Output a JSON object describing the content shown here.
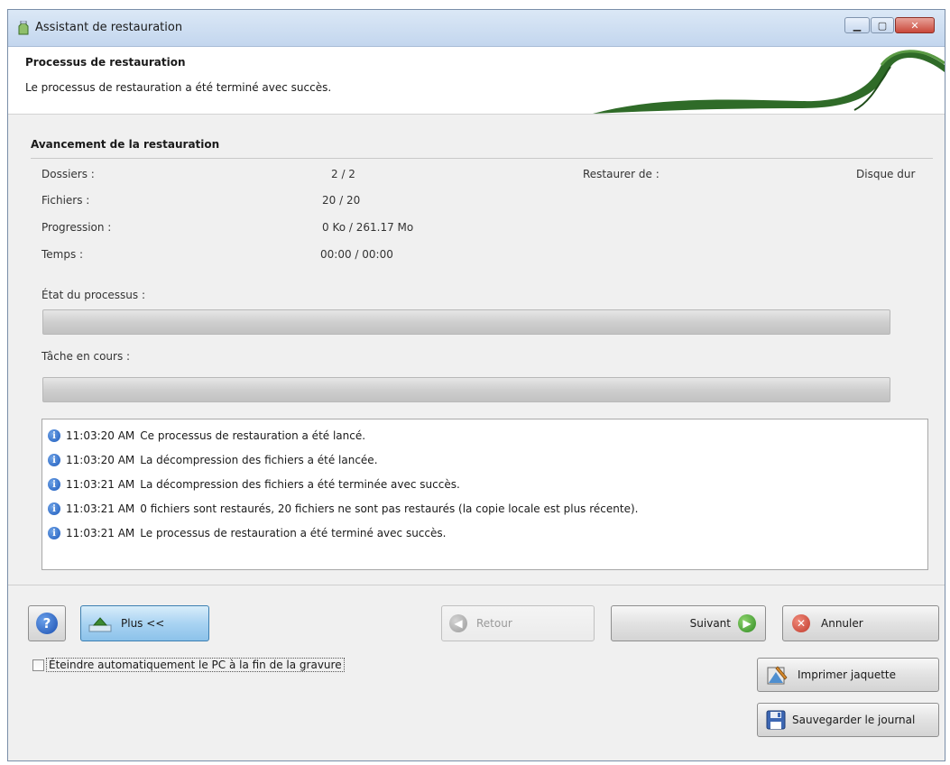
{
  "window": {
    "title": "Assistant de restauration"
  },
  "header": {
    "title": "Processus de restauration",
    "subtitle": "Le processus de restauration a été terminé avec succès."
  },
  "progress_section": {
    "title": "Avancement de la restauration",
    "folders_label": "Dossiers :",
    "folders_value": "2 / 2",
    "files_label": "Fichiers :",
    "files_value": "20  / 20",
    "progress_label": "Progression :",
    "progress_value": "0 Ko  / 261.17 Mo",
    "time_label": "Temps :",
    "time_value": "00:00  / 00:00",
    "restore_from_label": "Restaurer de :",
    "restore_from_value": "Disque dur",
    "process_state_label": "État du processus :",
    "process_state_fill": 0,
    "current_task_label": "Tâche en cours :",
    "current_task_fill": 0
  },
  "log": [
    {
      "time": "11:03:20 AM",
      "message": "Ce processus de restauration a été lancé."
    },
    {
      "time": "11:03:20 AM",
      "message": "La décompression des fichiers a été lancée."
    },
    {
      "time": "11:03:21 AM",
      "message": "La décompression des fichiers a été terminée avec succès."
    },
    {
      "time": "11:03:21 AM",
      "message": "0 fichiers sont restaurés, 20 fichiers ne sont pas restaurés (la copie locale est plus récente)."
    },
    {
      "time": "11:03:21 AM",
      "message": "Le processus de restauration a été terminé avec succès."
    }
  ],
  "buttons": {
    "more": "Plus <<",
    "back": "Retour",
    "next": "Suivant",
    "cancel": "Annuler",
    "print_cover": "Imprimer jaquette",
    "save_log": "Sauvegarder le journal"
  },
  "checkbox": {
    "shutdown_label": "Éteindre automatiquement le PC à la fin de la gravure",
    "checked": false
  },
  "colors": {
    "accent_green": "#2f7d2a",
    "info_blue": "#1d5bbd",
    "cancel_red": "#c0392b"
  }
}
